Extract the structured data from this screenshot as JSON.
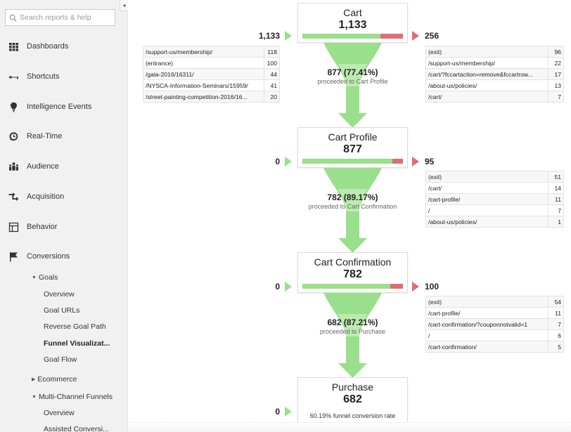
{
  "sidebar": {
    "collapse_glyph": "◂",
    "search": {
      "placeholder": "Search reports & help",
      "value": ""
    },
    "items": [
      {
        "label": "Dashboards",
        "icon": "grid-icon"
      },
      {
        "label": "Shortcuts",
        "icon": "shortcut-arrow-icon"
      },
      {
        "label": "Intelligence Events",
        "icon": "lightbulb-icon"
      },
      {
        "label": "Real-Time",
        "icon": "clock-icon"
      },
      {
        "label": "Audience",
        "icon": "people-icon"
      },
      {
        "label": "Acquisition",
        "icon": "acquisition-arrows-icon"
      },
      {
        "label": "Behavior",
        "icon": "layout-icon"
      },
      {
        "label": "Conversions",
        "icon": "flag-icon"
      }
    ],
    "goals_label": "Goals",
    "goals_items": [
      {
        "label": "Overview",
        "active": false
      },
      {
        "label": "Goal URLs",
        "active": false
      },
      {
        "label": "Reverse Goal Path",
        "active": false
      },
      {
        "label": "Funnel Visualizat...",
        "active": true
      },
      {
        "label": "Goal Flow",
        "active": false
      }
    ],
    "ecommerce_label": "Ecommerce",
    "mcf_label": "Multi-Channel Funnels",
    "mcf_items": [
      {
        "label": "Overview"
      },
      {
        "label": "Assisted Conversi..."
      }
    ]
  },
  "funnel": {
    "colors": {
      "proceed": "#9adf8b",
      "exit": "#df6d77"
    },
    "steps": [
      {
        "name": "Cart",
        "value": "1,133",
        "entries": "1,133",
        "exits": "256",
        "proceed_fraction": 0.7741,
        "proceed_text": "877 (77.41%)",
        "proceed_label": "proceeded to Cart Profile",
        "entry_paths": [
          {
            "url": "/support-us/membership/",
            "count": "118"
          },
          {
            "url": "(entrance)",
            "count": "100"
          },
          {
            "url": "/gala-2016/16311/",
            "count": "44"
          },
          {
            "url": "/NYSCA-Information-Seminars/15959/",
            "count": "41"
          },
          {
            "url": "/street-painting-competition-2016/16...",
            "count": "20"
          }
        ],
        "exit_paths": [
          {
            "url": "(exit)",
            "count": "96"
          },
          {
            "url": "/support-us/membership/",
            "count": "22"
          },
          {
            "url": "/cart/?fccartaction=remove&fccartrow...",
            "count": "17"
          },
          {
            "url": "/about-us/policies/",
            "count": "13"
          },
          {
            "url": "/cart/",
            "count": "7"
          }
        ]
      },
      {
        "name": "Cart Profile",
        "value": "877",
        "entries": "0",
        "exits": "95",
        "proceed_fraction": 0.8917,
        "proceed_text": "782 (89.17%)",
        "proceed_label": "proceeded to Cart Confirmation",
        "exit_paths": [
          {
            "url": "(exit)",
            "count": "51"
          },
          {
            "url": "/cart/",
            "count": "14"
          },
          {
            "url": "/cart-profile/",
            "count": "11"
          },
          {
            "url": "/",
            "count": "7"
          },
          {
            "url": "/about-us/policies/",
            "count": "1"
          }
        ]
      },
      {
        "name": "Cart Confirmation",
        "value": "782",
        "entries": "0",
        "exits": "100",
        "proceed_fraction": 0.8721,
        "proceed_text": "682 (87.21%)",
        "proceed_label": "proceeded to Purchase",
        "exit_paths": [
          {
            "url": "(exit)",
            "count": "54"
          },
          {
            "url": "/cart-profile/",
            "count": "11"
          },
          {
            "url": "/cart-confirmation/?couponnotvalid=1",
            "count": "7"
          },
          {
            "url": "/",
            "count": "6"
          },
          {
            "url": "/cart-confirmation/",
            "count": "5"
          }
        ]
      },
      {
        "name": "Purchase",
        "value": "682",
        "entries": "0",
        "conversion_text": "60.19% funnel conversion rate"
      }
    ]
  }
}
